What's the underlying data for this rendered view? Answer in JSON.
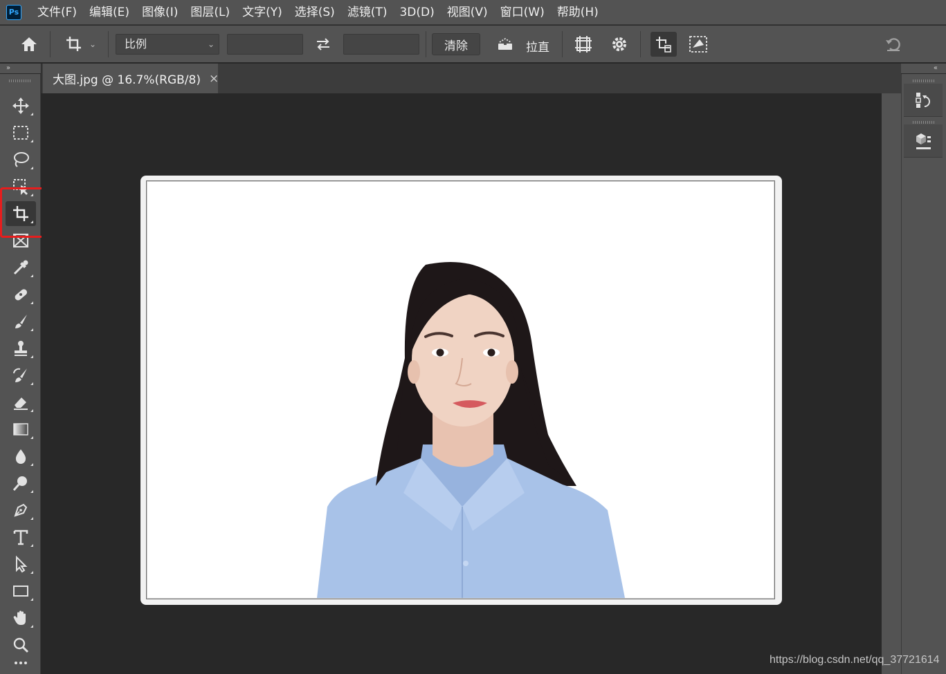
{
  "app": {
    "logo_text": "Ps"
  },
  "menu": [
    "文件(F)",
    "编辑(E)",
    "图像(I)",
    "图层(L)",
    "文字(Y)",
    "选择(S)",
    "滤镜(T)",
    "3D(D)",
    "视图(V)",
    "窗口(W)",
    "帮助(H)"
  ],
  "options_bar": {
    "ratio_select": "比例",
    "width_value": "",
    "height_value": "",
    "clear_label": "清除",
    "straighten_label": "拉直"
  },
  "toolbar": {
    "collapse_glyph": "»",
    "active_tool": "crop-tool",
    "tools": [
      "move-tool",
      "marquee-tool",
      "lasso-tool",
      "object-selection-tool",
      "crop-tool",
      "frame-tool",
      "eyedropper-tool",
      "healing-brush-tool",
      "brush-tool",
      "clone-stamp-tool",
      "history-brush-tool",
      "eraser-tool",
      "gradient-tool",
      "blur-tool",
      "dodge-tool",
      "pen-tool",
      "type-tool",
      "path-selection-tool",
      "rectangle-tool",
      "hand-tool",
      "zoom-tool",
      "more-tools"
    ]
  },
  "document": {
    "tab_title": "大图.jpg @ 16.7%(RGB/8)",
    "close_glyph": "×"
  },
  "right_panel": {
    "collapse_glyph": "«"
  },
  "watermark": "https://blog.csdn.net/qq_37721614",
  "colors": {
    "panel": "#535353",
    "canvas": "#282828",
    "highlight": "#e61d1d",
    "shirt": "#a8c2e8",
    "hair": "#1e1718",
    "skin": "#f0d3c3"
  }
}
